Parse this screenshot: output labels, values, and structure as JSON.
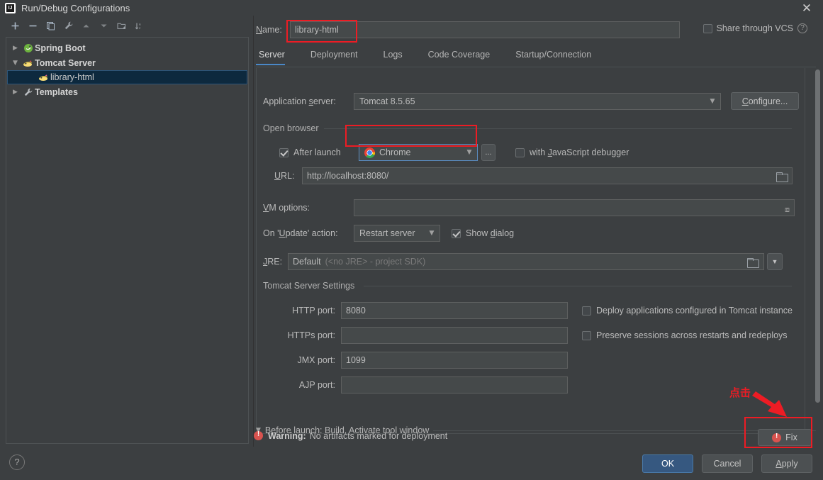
{
  "window": {
    "title": "Run/Debug Configurations",
    "close_label": "✕",
    "app_icon": "intellij-idea-icon"
  },
  "sidebar": {
    "toolbar": [
      {
        "name": "add-configuration-button",
        "icon": "plus-icon"
      },
      {
        "name": "remove-configuration-button",
        "icon": "minus-icon"
      },
      {
        "name": "copy-configuration-button",
        "icon": "copy-icon"
      },
      {
        "name": "edit-templates-button",
        "icon": "wrench-icon"
      },
      {
        "name": "move-up-button",
        "icon": "arrow-up-icon"
      },
      {
        "name": "move-down-button",
        "icon": "arrow-down-icon"
      },
      {
        "name": "move-into-folder-button",
        "icon": "folder-add-icon"
      },
      {
        "name": "sort-configurations-button",
        "icon": "sort-az-icon"
      }
    ],
    "tree": [
      {
        "label": "Spring Boot",
        "icon": "spring-boot-icon",
        "expanded": false,
        "arrow": "▶",
        "level": 0,
        "bold": true,
        "selected": false
      },
      {
        "label": "Tomcat Server",
        "icon": "tomcat-icon",
        "expanded": true,
        "arrow": "▼",
        "level": 0,
        "bold": true,
        "selected": false
      },
      {
        "label": "library-html",
        "icon": "tomcat-icon",
        "expanded": null,
        "arrow": "",
        "level": 1,
        "bold": false,
        "selected": true
      },
      {
        "label": "Templates",
        "icon": "wrench-icon",
        "expanded": false,
        "arrow": "▶",
        "level": 0,
        "bold": true,
        "selected": false
      }
    ]
  },
  "header": {
    "name_label": "Name:",
    "name_value": "library-html",
    "share_vcs_label": "Share through VCS",
    "share_vcs_checked": false,
    "help_icon": "question-mark-icon"
  },
  "tabs": [
    {
      "label": "Server",
      "active": true
    },
    {
      "label": "Deployment",
      "active": false
    },
    {
      "label": "Logs",
      "active": false
    },
    {
      "label": "Code Coverage",
      "active": false
    },
    {
      "label": "Startup/Connection",
      "active": false
    }
  ],
  "server_tab": {
    "application_server": {
      "label": "Application server:",
      "value": "Tomcat 8.5.65",
      "configure_button": "Configure..."
    },
    "open_browser": {
      "group_label": "Open browser",
      "after_launch_label": "After launch",
      "after_launch_checked": true,
      "browser_value": "Chrome",
      "browser_icon": "chrome-icon",
      "browse_button_label": "...",
      "js_debugger_label": "with JavaScript debugger",
      "js_debugger_checked": false,
      "url_label": "URL:",
      "url_value": "http://localhost:8080/",
      "url_browse_icon": "folder-icon"
    },
    "vm_options": {
      "label": "VM options:",
      "value": "",
      "expand_icon": "expand-arrows-icon"
    },
    "on_update_action": {
      "label": "On 'Update' action:",
      "value": "Restart server",
      "show_dialog_label": "Show dialog",
      "show_dialog_checked": true
    },
    "jre": {
      "label": "JRE:",
      "value": "Default",
      "hint": "(<no JRE> - project SDK)",
      "browse_icon": "folder-icon",
      "dropdown_icon": "chevron-down-icon"
    },
    "tomcat_settings": {
      "group_label": "Tomcat Server Settings",
      "ports": [
        {
          "label": "HTTP port:",
          "value": "8080"
        },
        {
          "label": "HTTPs port:",
          "value": ""
        },
        {
          "label": "JMX port:",
          "value": "1099"
        },
        {
          "label": "AJP port:",
          "value": ""
        }
      ],
      "checkboxes": [
        {
          "label": "Deploy applications configured in Tomcat instance",
          "checked": false
        },
        {
          "label": "Preserve sessions across restarts and redeploys",
          "checked": false
        }
      ]
    },
    "before_launch": {
      "arrow": "▼",
      "label": "Before launch: Build, Activate tool window"
    }
  },
  "status": {
    "warning_prefix": "Warning:",
    "warning_text": "No artifacts marked for deployment",
    "warning_icon": "error-circle-icon",
    "fix_button_label": "Fix",
    "fix_button_icon": "error-circle-icon"
  },
  "footer": {
    "help_label": "?",
    "ok_label": "OK",
    "cancel_label": "Cancel",
    "apply_label": "Apply"
  },
  "annotations": {
    "click_text": "点击",
    "accent_color": "#ed1c24"
  }
}
